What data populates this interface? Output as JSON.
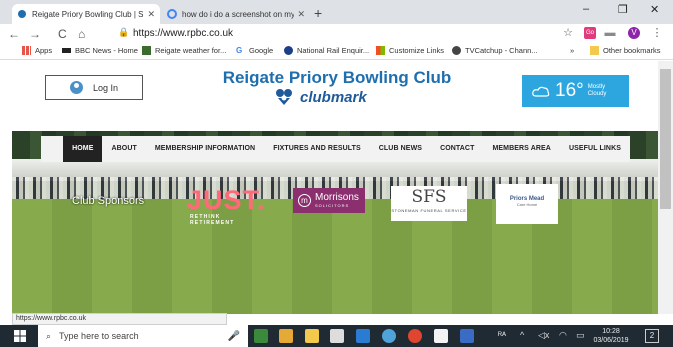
{
  "browser": {
    "tabs": [
      {
        "title": "Reigate Priory Bowling Club | Su",
        "active": true
      },
      {
        "title": "how do i do a screenshot on my",
        "active": false
      }
    ],
    "new_tab": "+",
    "window_controls": {
      "minimize": "–",
      "maximize": "❐",
      "close": "✕"
    },
    "nav": {
      "back": "←",
      "forward": "→",
      "reload": "C",
      "home": "⌂"
    },
    "url": "https://www.rpbc.co.uk",
    "bookmarks": [
      {
        "label": "Apps",
        "icon": "apps-grid-icon"
      },
      {
        "label": "BBC News - Home",
        "icon": "bbc-icon"
      },
      {
        "label": "Reigate weather for...",
        "icon": "weather-site-icon"
      },
      {
        "label": "Google",
        "icon": "google-icon"
      },
      {
        "label": "National Rail Enquir...",
        "icon": "national-rail-icon"
      },
      {
        "label": "Customize Links",
        "icon": "microsoft-icon"
      },
      {
        "label": "TVCatchup - Chann...",
        "icon": "tvcatchup-icon"
      }
    ],
    "bookmarks_overflow": "»",
    "other_bookmarks": "Other bookmarks",
    "profile_initial": "V"
  },
  "site": {
    "login_label": "Log In",
    "title": "Reigate Priory Bowling Club",
    "clubmark": "clubmark",
    "weather": {
      "temp": "16°",
      "desc": "Mostly Cloudy"
    },
    "nav_items": [
      {
        "label": "HOME",
        "active": true
      },
      {
        "label": "ABOUT",
        "active": false
      },
      {
        "label": "MEMBERSHIP INFORMATION",
        "active": false
      },
      {
        "label": "FIXTURES AND RESULTS",
        "active": false
      },
      {
        "label": "CLUB NEWS",
        "active": false
      },
      {
        "label": "CONTACT",
        "active": false
      },
      {
        "label": "MEMBERS AREA",
        "active": false
      },
      {
        "label": "USEFUL LINKS",
        "active": false
      }
    ],
    "sponsors_label": "Club Sponsors",
    "sponsors": {
      "just": {
        "name": "JUST.",
        "tagline": "RETHINK RETIREMENT"
      },
      "morrisons": {
        "name": "Morrisons",
        "sub": "SOLICITORS"
      },
      "sfs": {
        "name": "SFS",
        "sub": "STONEMAN FUNERAL SERVICE"
      },
      "priors": {
        "name": "Priors Mead",
        "sub": "Care Home"
      }
    }
  },
  "status_url": "https://www.rpbc.co.uk",
  "taskbar": {
    "search_placeholder": "Type here to search",
    "time": "10:28",
    "date": "03/06/2019",
    "notification_count": "2"
  },
  "colors": {
    "site_blue": "#1f6fae",
    "weather_bg": "#2da6e0",
    "just_pink": "#ff6a7a",
    "morrisons_purple": "#8b2f6e",
    "taskbar": "#1f2a33"
  }
}
